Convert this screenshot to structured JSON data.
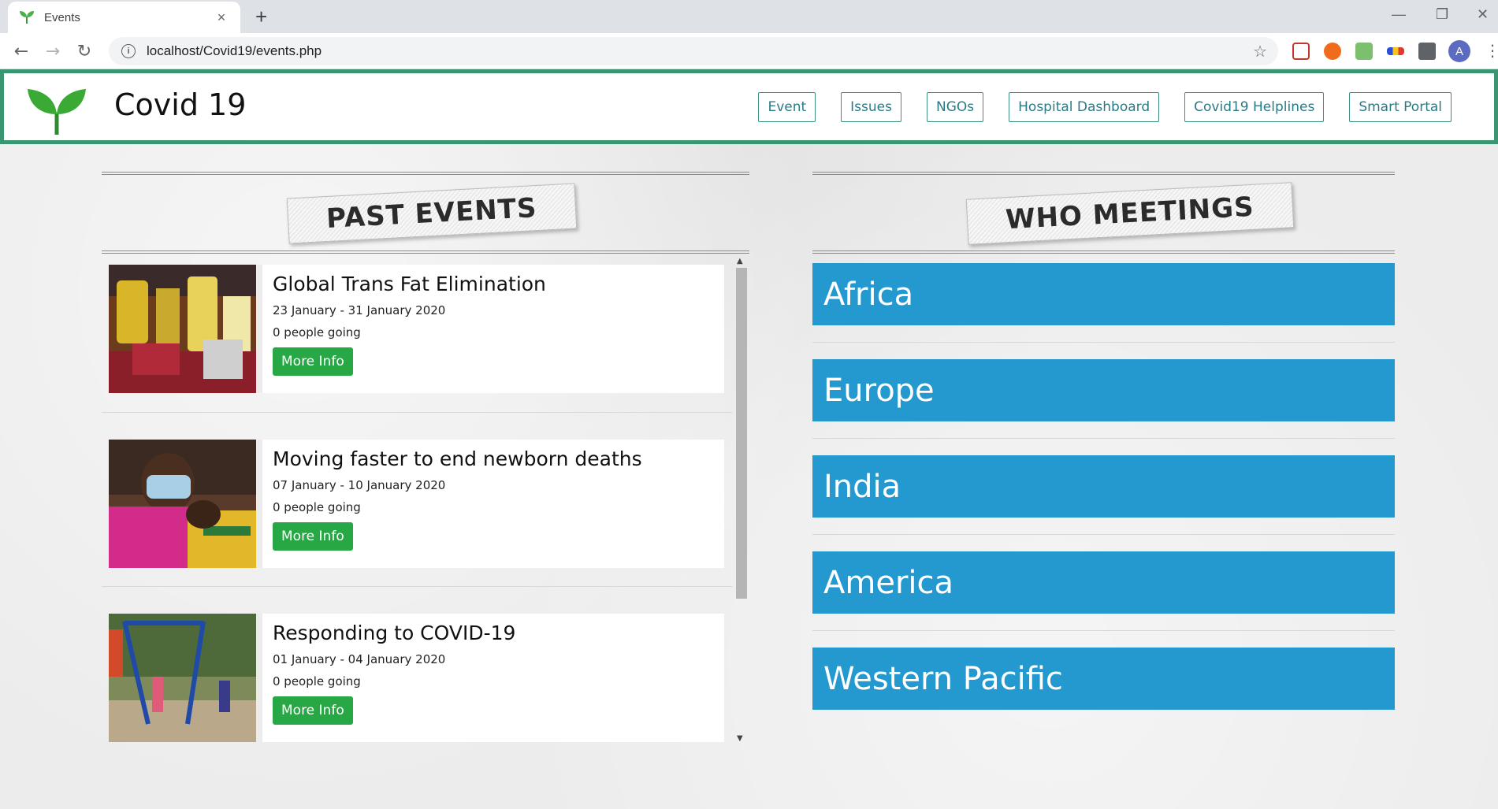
{
  "browser": {
    "tab_title": "Events",
    "tab_close": "×",
    "new_tab": "+",
    "url": "localhost/Covid19/events.php",
    "profile_initial": "A"
  },
  "site": {
    "title": "Covid 19",
    "brand_color": "#3a9670",
    "nav": [
      "Event",
      "Issues",
      "NGOs",
      "Hospital Dashboard",
      "Covid19 Helplines",
      "Smart Portal"
    ]
  },
  "past_events": {
    "heading": "PAST EVENTS",
    "button_label": "More Info",
    "items": [
      {
        "title": "Global Trans Fat Elimination",
        "date": "23 January - 31 January 2020",
        "going": "0 people going"
      },
      {
        "title": "Moving faster to end newborn deaths",
        "date": "07 January - 10 January 2020",
        "going": "0 people going"
      },
      {
        "title": "Responding to COVID-19",
        "date": "01 January - 04 January 2020",
        "going": "0 people going"
      }
    ]
  },
  "who_meetings": {
    "heading": "WHO MEETINGS",
    "accent_color": "#2399d0",
    "regions": [
      "Africa",
      "Europe",
      "India",
      "America",
      "Western Pacific"
    ]
  }
}
